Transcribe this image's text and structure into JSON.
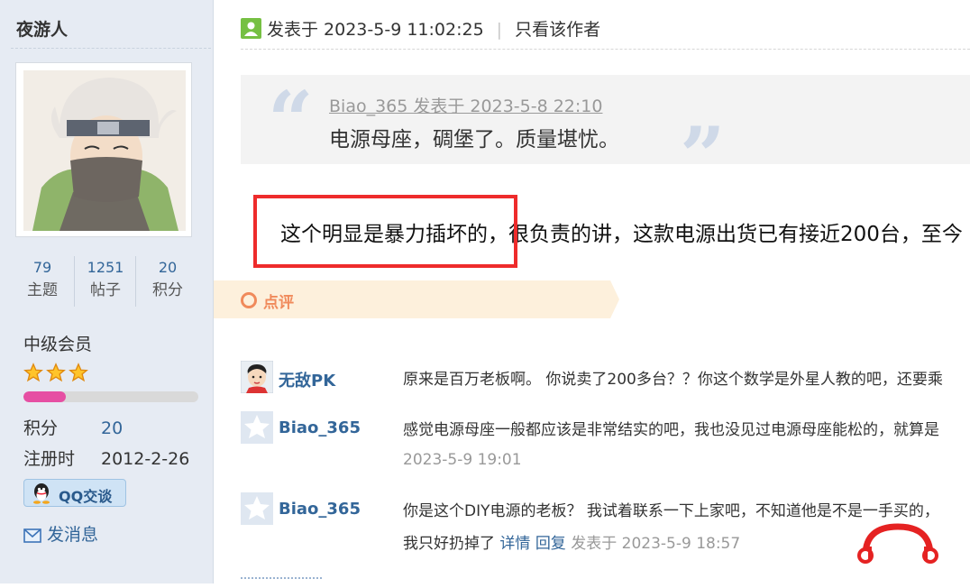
{
  "sidebar": {
    "username": "夜游人",
    "stats": [
      {
        "num": "79",
        "label": "主题"
      },
      {
        "num": "1251",
        "label": "帖子"
      },
      {
        "num": "20",
        "label": "积分"
      }
    ],
    "level": "中级会员",
    "stars": 3,
    "progress_fraction": 0.24,
    "credit_label": "积分",
    "credit_value": "20",
    "register_label": "注册时",
    "register_value": "2012-2-26",
    "qq_button": "QQ交谈",
    "message_link": "发消息"
  },
  "post": {
    "posted_at": "发表于 2023-5-9 11:02:25",
    "only_author": "只看该作者",
    "quote": {
      "meta": "Biao_365 发表于 2023-5-8 22:10",
      "text": "电源母座，碉堡了。质量堪忧。",
      "open_mark": "“",
      "close_mark": "”"
    },
    "body": "这个明显是暴力插坏的，很负责的讲，这款电源出货已有接近200台，至今"
  },
  "comments_label": "点评",
  "comments": [
    {
      "name": "无敌PK",
      "text": "原来是百万老板啊。 你说卖了200多台？？你这个数学是外星人教的吧，还要乘"
    },
    {
      "name": "Biao_365",
      "text": "感觉电源母座一般都应该是非常结实的吧，我也没见过电源母座能松的，就算是",
      "time": "2023-5-9 19:01"
    },
    {
      "name": "Biao_365",
      "text": "你是这个DIY电源的老板？ 我试着联系一下上家吧，不知道他是不是一手买的，",
      "line2_prefix": "我只好扔掉了",
      "detail_link": "详情",
      "reply_link": "回复",
      "line2_meta": "发表于 2023-5-9 18:57"
    }
  ],
  "colors": {
    "link": "#336699",
    "highlight_box": "#ee2b2b",
    "comment_accent": "#f08a5b",
    "progress": "#e64fa3",
    "sidebar_bg": "#e6ebf3"
  }
}
